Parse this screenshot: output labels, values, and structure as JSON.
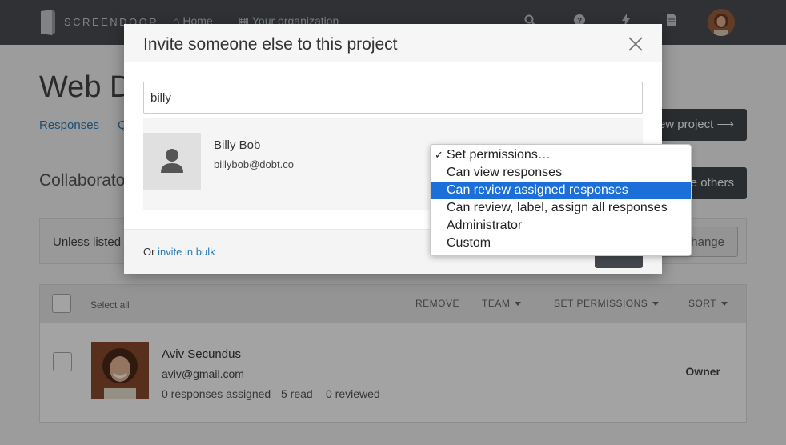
{
  "topbar": {
    "brand": "SCREENDOOR",
    "nav": [
      {
        "label": "Home",
        "icon": "home-icon"
      },
      {
        "label": "Your organization",
        "icon": "building-icon"
      }
    ],
    "icons": [
      "search-icon",
      "help-icon",
      "bolt-icon",
      "document-icon"
    ]
  },
  "page": {
    "title": "Web D",
    "tabs": [
      "Responses",
      "Q"
    ],
    "new_project_button": "ew project ⟶",
    "section_title": "Collaborato",
    "invite_others_button": "e others",
    "info_text": "Unless listed",
    "change_button": "hange"
  },
  "table": {
    "select_all": "Select all",
    "headers": {
      "remove": "REMOVE",
      "team": "TEAM",
      "set_permissions": "SET PERMISSIONS",
      "sort": "SORT"
    },
    "rows": [
      {
        "name": "Aviv Secundus",
        "email": "aviv@gmail.com",
        "assigned": "0 responses assigned",
        "read": "5 read",
        "reviewed": "0 reviewed",
        "role": "Owner"
      }
    ]
  },
  "modal": {
    "title": "Invite someone else to this project",
    "search_value": "billy",
    "result": {
      "name": "Billy Bob",
      "email": "billybob@dobt.co"
    },
    "footer_prefix": "Or ",
    "footer_link": "invite in bulk"
  },
  "permissions_dropdown": {
    "options": [
      {
        "label": "Set permissions…",
        "checked": true,
        "highlighted": false
      },
      {
        "label": "Can view responses",
        "checked": false,
        "highlighted": false
      },
      {
        "label": "Can review assigned responses",
        "checked": false,
        "highlighted": true
      },
      {
        "label": "Can review, label, assign all responses",
        "checked": false,
        "highlighted": false
      },
      {
        "label": "Administrator",
        "checked": false,
        "highlighted": false
      },
      {
        "label": "Custom",
        "checked": false,
        "highlighted": false
      }
    ],
    "check_glyph": "✓"
  },
  "colors": {
    "topbar": "#4a4d52",
    "link": "#2a7ab8",
    "highlight": "#1c6fd8",
    "dark_button": "#43474c"
  }
}
